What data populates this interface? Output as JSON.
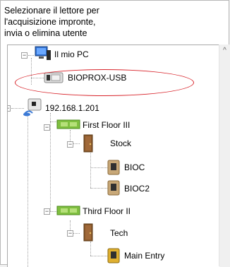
{
  "caption": {
    "line1": "Selezionare il lettore per",
    "line2": "l'acquisizione impronte,",
    "line3": "invia o elimina utente"
  },
  "tree": {
    "items": [
      {
        "label": "Il mio PC",
        "icon": "computer-icon",
        "state": "expanded"
      },
      {
        "label": "BIOPROX-USB",
        "icon": "usb-reader-icon",
        "highlighted": true
      },
      {
        "label": "192.168.1.201",
        "icon": "network-device-icon",
        "state": "expanded"
      },
      {
        "label": "First Floor III",
        "icon": "floor-icon",
        "state": "expanded"
      },
      {
        "label": "Stock",
        "icon": "door-icon",
        "state": "expanded"
      },
      {
        "label": "BIOC",
        "icon": "reader-icon"
      },
      {
        "label": "BIOC2",
        "icon": "reader-icon"
      },
      {
        "label": "Third Floor II",
        "icon": "floor-icon",
        "state": "expanded"
      },
      {
        "label": "Tech",
        "icon": "door-icon",
        "state": "expanded"
      },
      {
        "label": "Main Entry",
        "icon": "reader-icon"
      }
    ]
  },
  "colors": {
    "highlight": "#d8232a",
    "floor": "#7fbf3f",
    "door": "#8b5a2b"
  }
}
